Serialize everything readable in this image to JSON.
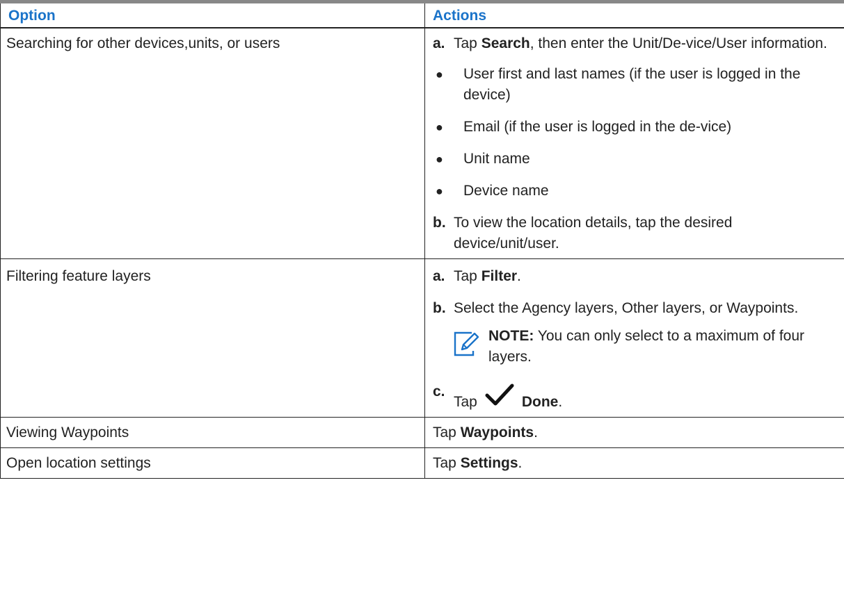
{
  "table": {
    "headers": {
      "option": "Option",
      "actions": "Actions"
    },
    "rows": [
      {
        "option": "Searching for other devices,units, or users",
        "steps": [
          {
            "label": "a.",
            "pre": "Tap ",
            "bold": "Search",
            "post": ", then enter the Unit/De-vice/User information."
          },
          {
            "label": "b.",
            "text": "To view the location details, tap the desired device/unit/user."
          }
        ],
        "bullets": [
          "User first and last names (if the user is logged in the device)",
          "Email (if the user is logged in the de-vice)",
          "Unit name",
          "Device name"
        ]
      },
      {
        "option": "Filtering feature layers",
        "steps": [
          {
            "label": "a.",
            "pre": "Tap ",
            "bold": "Filter",
            "post": "."
          },
          {
            "label": "b.",
            "text": "Select the Agency layers, Other layers, or Waypoints."
          },
          {
            "label": "c.",
            "pre": "Tap",
            "bold": "Done",
            "post": ".",
            "icon": "checkmark-icon"
          }
        ],
        "note": {
          "label": "NOTE:",
          "text": " You can only select to a maximum of four layers.",
          "icon": "note-pencil-icon"
        }
      },
      {
        "option": "Viewing Waypoints",
        "pre": "Tap ",
        "bold": "Waypoints",
        "post": "."
      },
      {
        "option": "Open location settings",
        "pre": "Tap ",
        "bold": "Settings",
        "post": "."
      }
    ]
  },
  "colors": {
    "header_text": "#1a73c9",
    "header_rule": "#888888",
    "note_icon": "#1a73c9"
  }
}
